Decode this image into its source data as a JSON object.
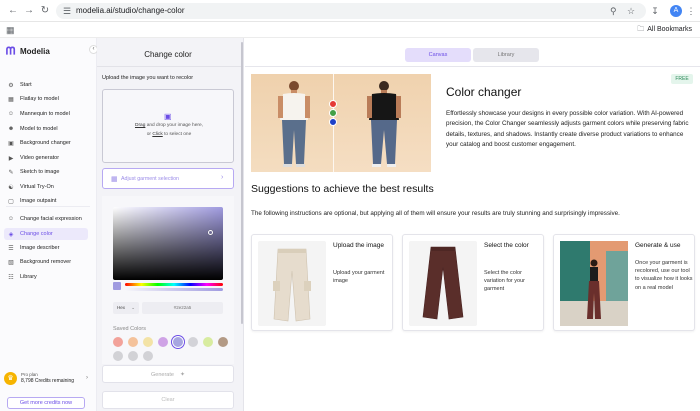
{
  "browser": {
    "url": "modelia.ai/studio/change-color",
    "all_bookmarks": "All Bookmarks",
    "profile_initial": "A"
  },
  "app": {
    "name": "Modelia",
    "brand_color": "#6b4de6"
  },
  "sidebar": {
    "items": [
      {
        "label": "Start",
        "icon": "start-icon"
      },
      {
        "label": "Flatlay to model",
        "icon": "flatlay-icon"
      },
      {
        "label": "Mannequin to model",
        "icon": "mannequin-icon"
      },
      {
        "label": "Model to model",
        "icon": "model-icon"
      },
      {
        "label": "Background changer",
        "icon": "background-icon"
      },
      {
        "label": "Video generator",
        "icon": "video-icon"
      },
      {
        "label": "Sketch to image",
        "icon": "sketch-icon"
      },
      {
        "label": "Virtual Try-On",
        "icon": "tryon-icon"
      },
      {
        "label": "Image outpaint",
        "icon": "outpaint-icon"
      },
      {
        "label": "Change facial expression",
        "icon": "face-icon"
      },
      {
        "label": "Change color",
        "icon": "palette-icon",
        "active": true
      },
      {
        "label": "Image describer",
        "icon": "describe-icon"
      },
      {
        "label": "Background remover",
        "icon": "remove-bg-icon"
      },
      {
        "label": "Library",
        "icon": "library-icon"
      }
    ],
    "plan": {
      "name": "Pro plan",
      "credits": "8,798 Credits remaining"
    },
    "get_credits": "Get more credits now"
  },
  "panel": {
    "title": "Change color",
    "upload_label": "Upload the image you want to recolor",
    "drop_drag": "Drag",
    "drop_rest": " and drop your image here,",
    "drop_or": "or ",
    "drop_click": "Click",
    "drop_select": " to select one",
    "adjust_label": "Adjust garment selection",
    "picker": {
      "selected_color": "#a09be0",
      "format": "Hex",
      "hex_value": "#2e22a5"
    },
    "saved_colors_label": "Saved Colors",
    "saved_colors": [
      "#f2a29a",
      "#f4c29b",
      "#f3e3a6",
      "#cfa3e6",
      "#a7a6e0",
      "#d3d3d8",
      "#d8eca0",
      "#b39a85",
      "#d2d2d6",
      "#d2d2d6",
      "#d2d2d6"
    ],
    "generate": "Generate",
    "clear": "Clear"
  },
  "main": {
    "tabs": [
      {
        "label": "Canvas",
        "active": true
      },
      {
        "label": "Library",
        "active": false
      }
    ],
    "badge": "FREE",
    "title": "Color changer",
    "description": "Effortlessly showcase your designs in every possible color variation. With AI-powered precision, the Color Changer seamlessly adjusts garment colors while preserving fabric details, textures, and shadows. Instantly create diverse product variations to enhance your catalog and boost customer engagement.",
    "hero_dot_colors": [
      "#e53935",
      "#43a047",
      "#1e40c8"
    ],
    "suggestions_title": "Suggestions to achieve the best results",
    "suggestions_desc": "The following instructions are optional, but applying all of them will ensure your results are truly stunning and surprisingly impressive.",
    "cards": [
      {
        "title": "Upload the image",
        "desc": "Upload your garment image"
      },
      {
        "title": "Select the color",
        "desc": "Select the color variation for your garment"
      },
      {
        "title": "Generate & use",
        "desc": "Once your garment is recolored, use our tool to visualize how it looks on a real model"
      }
    ]
  }
}
